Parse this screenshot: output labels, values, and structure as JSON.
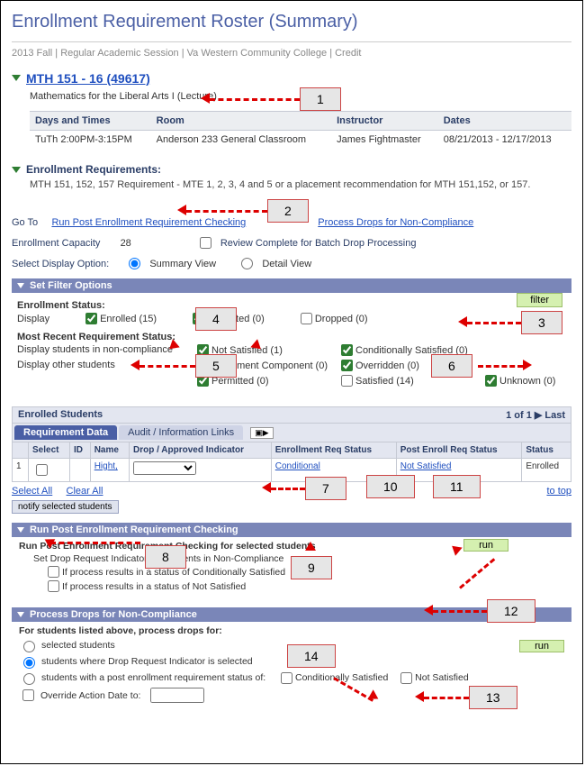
{
  "page_title": "Enrollment Requirement Roster (Summary)",
  "breadcrumb": "2013 Fall | Regular Academic Session | Va Western Community College | Credit",
  "course": {
    "link": "MTH 151 - 16 (49617)",
    "desc": "Mathematics for the Liberal Arts I (Lecture)"
  },
  "sched": {
    "h_days": "Days and Times",
    "h_room": "Room",
    "h_instr": "Instructor",
    "h_dates": "Dates",
    "days": "TuTh 2:00PM-3:15PM",
    "room": "Anderson 233 General Classroom",
    "instr": "James Fightmaster",
    "dates": "08/21/2013 - 12/17/2013"
  },
  "req": {
    "label": "Enrollment Requirements:",
    "text": "MTH 151, 152, 157  Requirement - MTE 1, 2, 3, 4 and 5 or a placement recommendation for MTH 151,152, or 157."
  },
  "goto_lbl": "Go To",
  "link_runpost": "Run Post Enrollment Requirement Checking",
  "link_drops": "Process Drops for Non-Compliance",
  "cap_lbl": "Enrollment Capacity",
  "cap_val": "28",
  "review_lbl": "Review Complete for Batch Drop Processing",
  "disp_lbl": "Select Display Option:",
  "disp_summary": "Summary View",
  "disp_detail": "Detail View",
  "filter": {
    "bar": "Set Filter Options",
    "btn": "filter",
    "status_lbl": "Enrollment Status:",
    "display_lbl": "Display",
    "enrolled": "Enrolled (15)",
    "waitlisted": "Waitlisted (0)",
    "dropped": "Dropped (0)",
    "recent_lbl": "Most Recent Requirement Status:",
    "nc_lbl": "Display students in non-compliance",
    "notsat": "Not Satisfied (1)",
    "condsat": "Conditionally Satisfied (0)",
    "other_lbl": "Display other students",
    "enrcomp": "Enrollment Component (0)",
    "overridden": "Overridden (0)",
    "permitted": "Permitted (0)",
    "satisfied": "Satisfied (14)",
    "unknown": "Unknown (0)"
  },
  "enrolled_hdr": "Enrolled Students",
  "pager": "1 of 1  ▶  Last",
  "tabs": {
    "req": "Requirement Data",
    "audit": "Audit / Information Links"
  },
  "expand": "▣▶",
  "cols": {
    "select": "Select",
    "id": "ID",
    "name": "Name",
    "drop": "Drop / Approved Indicator",
    "enr": "Enrollment Req Status",
    "post": "Post Enroll Req Status",
    "status": "Status"
  },
  "row1": {
    "n": "1",
    "name": "Hight,",
    "enr": "Conditional",
    "post": "Not Satisfied",
    "status": "Enrolled"
  },
  "sel_all": "Select All",
  "clr_all": "Clear All",
  "to_top": "to top",
  "notify": "notify selected students",
  "runpost": {
    "bar": "Run Post Enrollment Requirement Checking",
    "line1": "Run Post Enrollment Requirement Checking for selected students",
    "line2": "Set Drop Request Indicator for Students in Non-Compliance",
    "opt1": "If process results in a status of Conditionally Satisfied",
    "opt2": "If process results in a status of Not Satisfied",
    "btn": "run"
  },
  "drops": {
    "bar": "Process Drops for Non-Compliance",
    "line1": "For students listed above, process drops for:",
    "opt1": "selected students",
    "opt2": "students where Drop Request Indicator is selected",
    "opt3": "students with a post enrollment requirement status of:",
    "cs": "Conditionally Satisfied",
    "ns": "Not Satisfied",
    "override": "Override Action Date to:",
    "btn": "run"
  },
  "callouts": {
    "c1": "1",
    "c2": "2",
    "c3": "3",
    "c4": "4",
    "c5": "5",
    "c6": "6",
    "c7": "7",
    "c8": "8",
    "c9": "9",
    "c10": "10",
    "c11": "11",
    "c12": "12",
    "c13": "13",
    "c14": "14"
  }
}
